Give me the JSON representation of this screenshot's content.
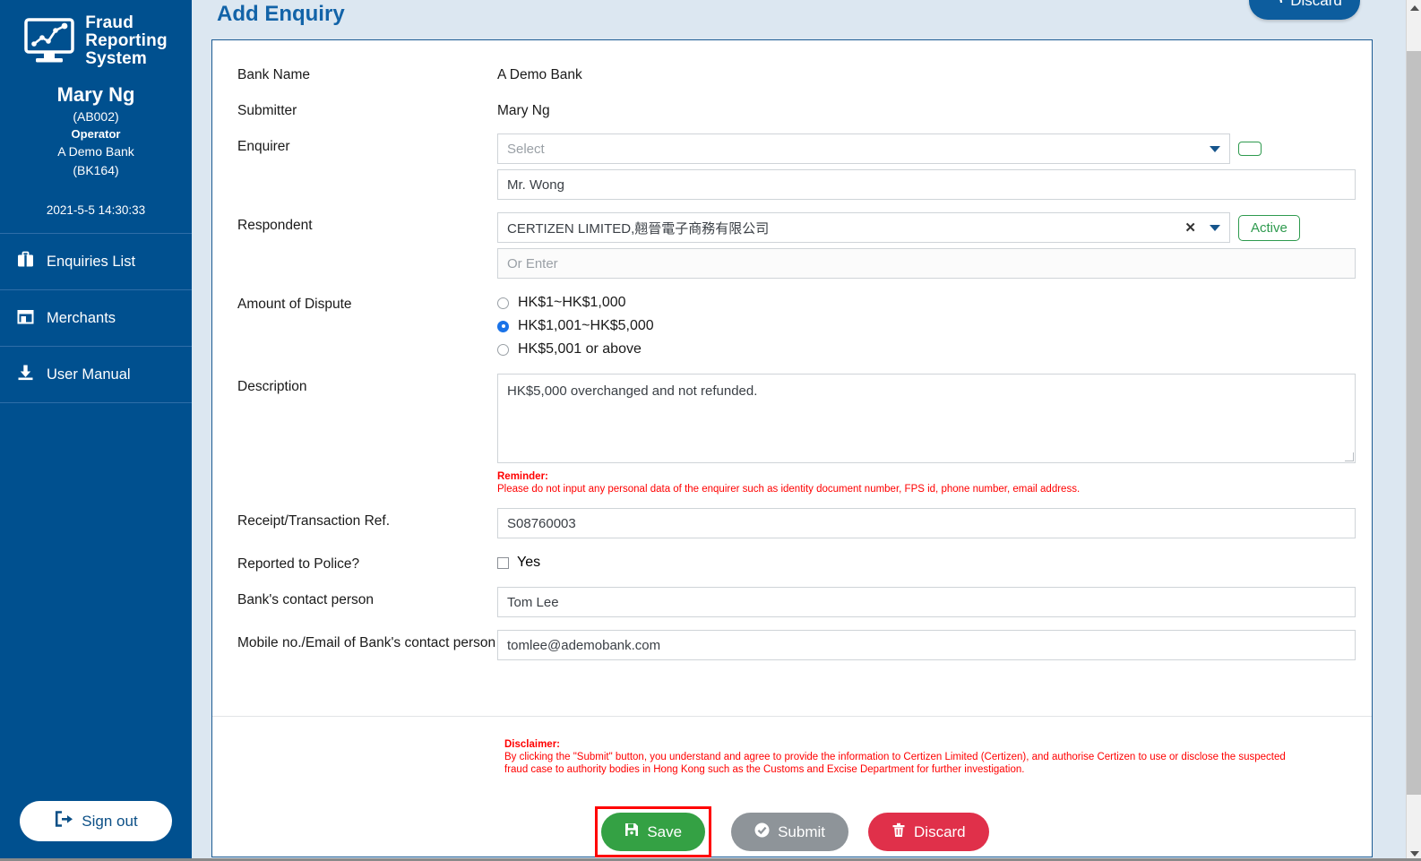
{
  "sidebar": {
    "brand": {
      "line1": "Fraud",
      "line2": "Reporting",
      "line3": "System",
      "icon": "monitor-chart-icon"
    },
    "user": {
      "name": "Mary Ng",
      "id": "(AB002)",
      "role": "Operator",
      "bank": "A Demo Bank",
      "bank_code": "(BK164)"
    },
    "clock": "2021-5-5 14:30:33",
    "items": [
      {
        "label": "Enquiries List",
        "icon": "briefcase-icon"
      },
      {
        "label": "Merchants",
        "icon": "store-icon"
      },
      {
        "label": "User Manual",
        "icon": "download-icon"
      }
    ],
    "signout_label": "Sign out",
    "signout_icon": "sign-out-icon"
  },
  "header": {
    "title": "Add Enquiry",
    "discard_label": "Discard",
    "discard_icon": "back-arrow-icon"
  },
  "form": {
    "bank_name": {
      "label": "Bank Name",
      "value": "A Demo Bank"
    },
    "submitter": {
      "label": "Submitter",
      "value": "Mary Ng"
    },
    "enquirer": {
      "label": "Enquirer",
      "select_placeholder": "Select",
      "select_value": "",
      "name_value": "Mr. Wong",
      "badge": ""
    },
    "respondent": {
      "label": "Respondent",
      "value": "CERTIZEN LIMITED,翹晉電子商務有限公司",
      "or_enter_placeholder": "Or Enter",
      "or_enter_value": "",
      "status_badge": "Active"
    },
    "amount": {
      "label": "Amount of Dispute",
      "options": [
        {
          "label": "HK$1~HK$1,000",
          "selected": false
        },
        {
          "label": "HK$1,001~HK$5,000",
          "selected": true
        },
        {
          "label": "HK$5,001 or above",
          "selected": false
        }
      ]
    },
    "description": {
      "label": "Description",
      "value": "HK$5,000 overchanged and not refunded.",
      "reminder_title": "Reminder:",
      "reminder_text": "Please do not input any personal data of the enquirer such as identity document number, FPS id, phone number, email address."
    },
    "receipt_ref": {
      "label": "Receipt/Transaction Ref.",
      "value": "S08760003"
    },
    "reported_police": {
      "label": "Reported to Police?",
      "checkbox_label": "Yes",
      "checked": false
    },
    "contact_person": {
      "label": "Bank's contact person",
      "value": "Tom Lee"
    },
    "contact_detail": {
      "label": "Mobile no./Email of Bank's contact person",
      "value": "tomlee@ademobank.com"
    }
  },
  "disclaimer": {
    "title": "Disclaimer:",
    "line1": "By clicking the \"Submit\" button, you understand and agree to provide the information to Certizen Limited (Certizen), and authorise Certizen to use or disclose the suspected",
    "line2": "fraud case to authority bodies in Hong Kong such as the Customs and Excise Department for further investigation."
  },
  "actions": {
    "save": {
      "label": "Save",
      "icon": "floppy-disk-icon",
      "color": "#34a144",
      "highlighted": true
    },
    "submit": {
      "label": "Submit",
      "icon": "check-circle-icon",
      "color": "#8e9499"
    },
    "discard": {
      "label": "Discard",
      "icon": "trash-icon",
      "color": "#e0304a"
    }
  }
}
